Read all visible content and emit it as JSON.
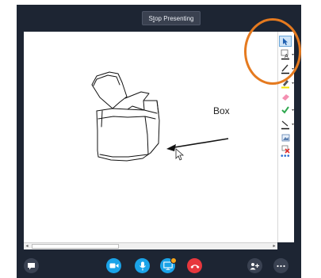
{
  "header": {
    "stop_presenting_label": "Stop Presenting",
    "stop_presenting_prefix": "S",
    "stop_presenting_access_key": "t",
    "stop_presenting_suffix": "op Presenting"
  },
  "whiteboard": {
    "annotation_label": "Box",
    "cursor": "pointer-arrow-icon"
  },
  "toolbar": {
    "tools": [
      {
        "name": "select-tool",
        "icon": "cursor-select-icon",
        "selected": true
      },
      {
        "name": "text-tool",
        "icon": "text-a-icon",
        "dropdown": true
      },
      {
        "name": "line-color-tool",
        "icon": "line-color-icon"
      },
      {
        "name": "pen-tool",
        "icon": "pen-icon",
        "dropdown": true
      },
      {
        "name": "highlighter-tool",
        "icon": "highlighter-icon",
        "dropdown": true
      },
      {
        "name": "eraser-tool",
        "icon": "eraser-icon"
      },
      {
        "name": "stamp-tool",
        "icon": "checkmark-icon",
        "dropdown": true
      },
      {
        "name": "shape-tool",
        "icon": "arrow-line-icon",
        "dropdown": true
      },
      {
        "name": "insert-picture-tool",
        "icon": "picture-icon"
      },
      {
        "name": "delete-tool",
        "icon": "delete-x-icon",
        "dropdown": true
      },
      {
        "name": "more-tools",
        "icon": "more-dots-icon"
      }
    ],
    "more_dots": "•••"
  },
  "call_controls": [
    {
      "name": "chat-button",
      "icon": "chat-bubble-icon"
    },
    {
      "name": "video-button",
      "icon": "video-camera-icon"
    },
    {
      "name": "mute-button",
      "icon": "microphone-icon"
    },
    {
      "name": "share-screen-button",
      "icon": "monitor-share-icon"
    },
    {
      "name": "end-call-button",
      "icon": "phone-hangup-icon"
    },
    {
      "name": "add-participant-button",
      "icon": "people-add-icon"
    },
    {
      "name": "more-options-button",
      "icon": "ellipsis-icon"
    }
  ],
  "colors": {
    "window_bg": "#1d2533",
    "accent_blue": "#1aa3e8",
    "end_call_red": "#e7373d",
    "highlight_orange": "#e57a1f",
    "badge_orange": "#f7a51a"
  }
}
